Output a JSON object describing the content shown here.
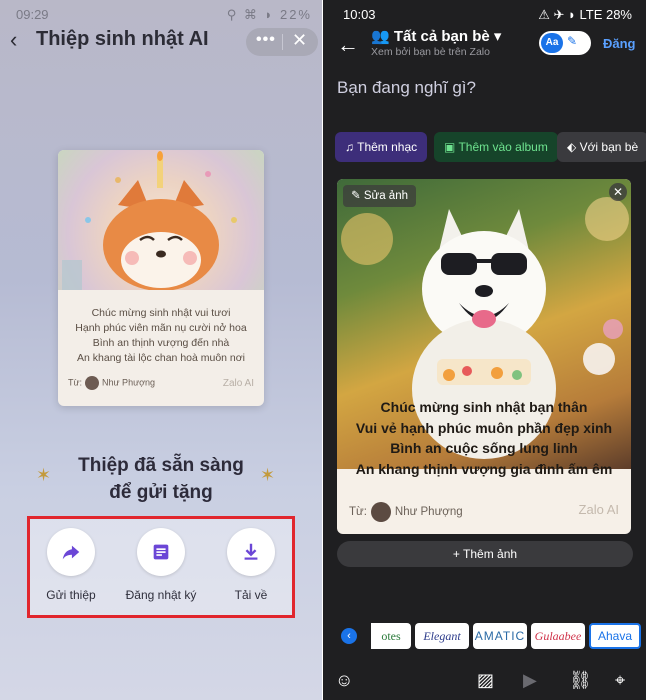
{
  "left": {
    "status": {
      "time": "09:29",
      "right": "⚲ ⌘ ◗ 22%"
    },
    "title": "Thiệp sinh nhật AI",
    "more_label": "•••",
    "close_label": "✕",
    "card": {
      "lines": [
        "Chúc mừng sinh nhật vui tươi",
        "Hạnh phúc viên mãn nụ cười nở hoa",
        "Bình an thịnh vượng đến nhà",
        "An khang tài lộc chan hoà muôn nơi"
      ],
      "from_label": "Từ:",
      "author": "Như Phượng",
      "brand": "Zalo AI"
    },
    "ready_line1": "Thiệp đã sẵn sàng",
    "ready_line2": "để gửi tặng",
    "actions": [
      {
        "label": "Gửi thiệp",
        "icon": "share-arrow-icon"
      },
      {
        "label": "Đăng nhật ký",
        "icon": "post-diary-icon"
      },
      {
        "label": "Tải về",
        "icon": "download-icon"
      }
    ],
    "highlight_color": "#e1262d",
    "accent_color": "#6b46d6"
  },
  "right": {
    "status": {
      "time": "10:03",
      "battery": "28%",
      "right": "⚠ ✈ ◗ LTE 28%"
    },
    "audience": "Tất cả bạn bè",
    "audience_sub": "Xem bởi bạn bè trên Zalo",
    "toggle_label": "Aa",
    "post_label": "Đăng",
    "prompt": "Bạn đang nghĩ gì?",
    "chips": [
      "Thêm nhạc",
      "Thêm vào album",
      "Với bạn bè"
    ],
    "edit_label": "Sửa ảnh",
    "close_label": "✕",
    "photo": {
      "lines": [
        "Chúc mừng sinh nhật bạn thân",
        "Vui vẻ hạnh phúc muôn phần đẹp xinh",
        "Bình an cuộc sống lung linh",
        "An khang thịnh vượng gia đình ấm êm"
      ],
      "from_label": "Từ:",
      "author": "Như Phượng",
      "brand": "Zalo AI"
    },
    "add_photo": "+ Thêm ảnh",
    "fonts": [
      "otes",
      "Elegant",
      "AMATIC",
      "Gulaabee",
      "Ahava"
    ],
    "accent_color": "#1a73e8"
  }
}
